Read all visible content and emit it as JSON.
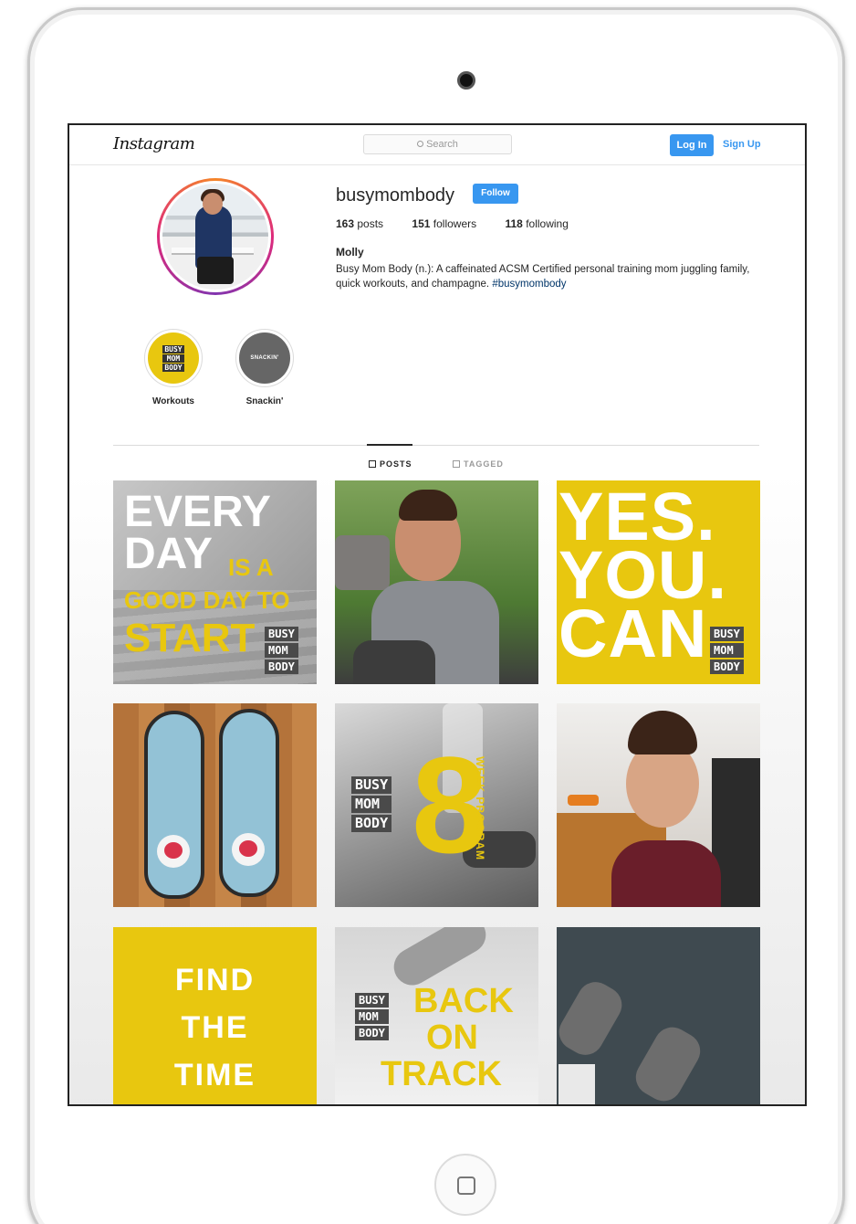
{
  "header": {
    "logo": "Instagram",
    "search_placeholder": "Search",
    "login_label": "Log In",
    "signup_label": "Sign Up"
  },
  "profile": {
    "username": "busymombody",
    "follow_label": "Follow",
    "posts_count": "163",
    "posts_label": "posts",
    "followers_count": "151",
    "followers_label": "followers",
    "following_count": "118",
    "following_label": "following",
    "full_name": "Molly",
    "bio_text": "Busy Mom Body (n.): A caffeinated ACSM Certified personal training mom juggling family, quick workouts, and champagne.",
    "bio_hashtag": "#busymombody"
  },
  "highlights": [
    {
      "label": "Workouts",
      "badge_lines": [
        "BUSY",
        "MOM",
        "BODY"
      ]
    },
    {
      "label": "Snackin'",
      "badge_text": "SNACKIN'"
    }
  ],
  "tabs": [
    {
      "label": "POSTS",
      "active": true
    },
    {
      "label": "TAGGED",
      "active": false
    }
  ],
  "posts": {
    "p1": {
      "line1": "EVERY",
      "line2a": "DAY",
      "line2b": "IS A",
      "line3": "GOOD DAY TO",
      "line4": "START",
      "badge": [
        "BUSY",
        "MOM",
        "BODY"
      ]
    },
    "p3": {
      "line1": "YES.",
      "line2": "YOU.",
      "line3": "CAN.",
      "badge": [
        "BUSY",
        "MOM",
        "BODY"
      ]
    },
    "p5": {
      "number": "8",
      "vertical": "WEEK PROGRAM",
      "badge": [
        "BUSY",
        "MOM",
        "BODY"
      ]
    },
    "p7": {
      "line1": "FIND",
      "line2": "THE",
      "line3": "TIME"
    },
    "p8": {
      "line1": "BACK",
      "line2": "ON",
      "line3": "TRACK",
      "badge": [
        "BUSY",
        "MOM",
        "BODY"
      ]
    }
  },
  "colors": {
    "accent": "#3897f0",
    "brand_yellow": "#e8c70f",
    "hashtag": "#003569"
  }
}
